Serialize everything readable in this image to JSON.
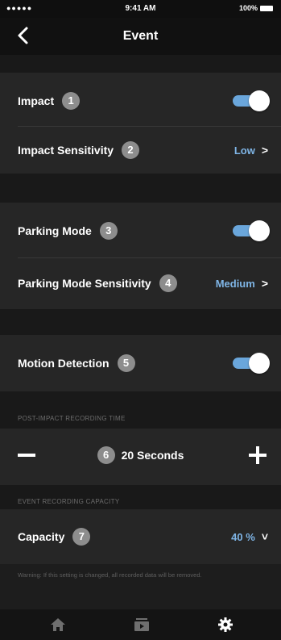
{
  "status_bar": {
    "signal": "●●●●●",
    "time": "9:41 AM",
    "battery": "100%"
  },
  "header": {
    "title": "Event"
  },
  "impact": {
    "label": "Impact",
    "badge": "1",
    "enabled": true
  },
  "impact_sensitivity": {
    "label": "Impact Sensitivity",
    "badge": "2",
    "value": "Low",
    "chevron": ">"
  },
  "parking_mode": {
    "label": "Parking Mode",
    "badge": "3",
    "enabled": true
  },
  "parking_sensitivity": {
    "label": "Parking Mode Sensitivity",
    "badge": "4",
    "value": "Medium",
    "chevron": ">"
  },
  "motion_detection": {
    "label": "Motion Detection",
    "badge": "5",
    "enabled": true
  },
  "post_impact": {
    "section_title": "POST-IMPACT RECORDING TIME",
    "badge": "6",
    "value": "20 Seconds"
  },
  "capacity": {
    "section_title": "EVENT RECORDING CAPACITY",
    "label": "Capacity",
    "badge": "7",
    "value": "40 %",
    "chevron": "˅",
    "warning": "Warning: If this setting is changed, all recorded data will be removed."
  },
  "tabs": [
    {
      "icon": "home-icon"
    },
    {
      "icon": "video-library-icon"
    },
    {
      "icon": "settings-gear-icon",
      "active": true
    }
  ],
  "colors": {
    "accent": "#6aa6db",
    "value_text": "#7fb5e6",
    "background": "#1d1d1d",
    "row_bg": "#262626"
  }
}
